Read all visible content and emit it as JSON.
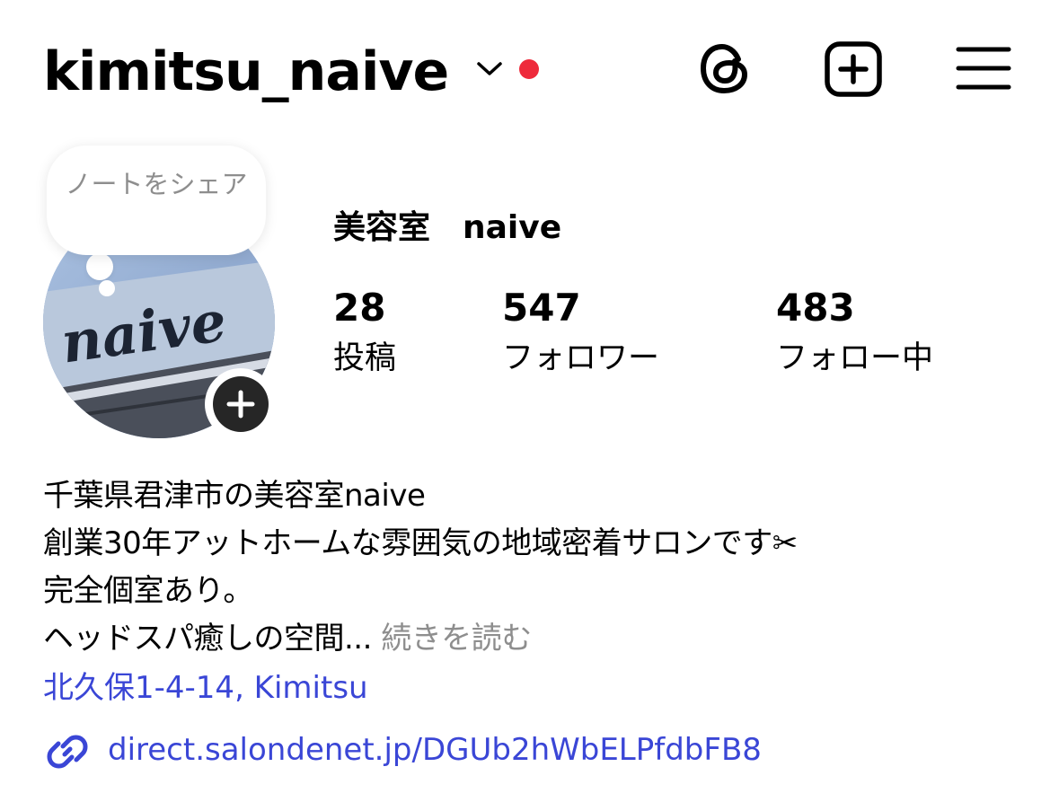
{
  "header": {
    "username": "kimitsu_naive",
    "accent_dot_color": "#ee2a3b",
    "icons": [
      "chevron-down-icon",
      "threads-icon",
      "new-post-icon",
      "menu-icon"
    ]
  },
  "note": {
    "text": "ノートをシェア"
  },
  "avatar": {
    "logo_text": "naive"
  },
  "profile": {
    "display_name": "美容室　naive",
    "stats": {
      "posts": {
        "count": "28",
        "label": "投稿"
      },
      "followers": {
        "count": "547",
        "label": "フォロワー"
      },
      "following": {
        "count": "483",
        "label": "フォロー中"
      }
    }
  },
  "bio": {
    "line1": "千葉県君津市の美容室naive",
    "line2": "創業30年アットホームな雰囲気の地域密着サロンです✂︎",
    "line3": "完全個室あり。",
    "line4": "ヘッドスパ癒しの空間...",
    "more": "続きを読む",
    "location": "北久保1-4-14, Kimitsu",
    "link": "direct.salondenet.jp/DGUb2hWbELPfdbFB8"
  },
  "colors": {
    "link": "#3a46d6",
    "muted": "#8e8e8e"
  }
}
